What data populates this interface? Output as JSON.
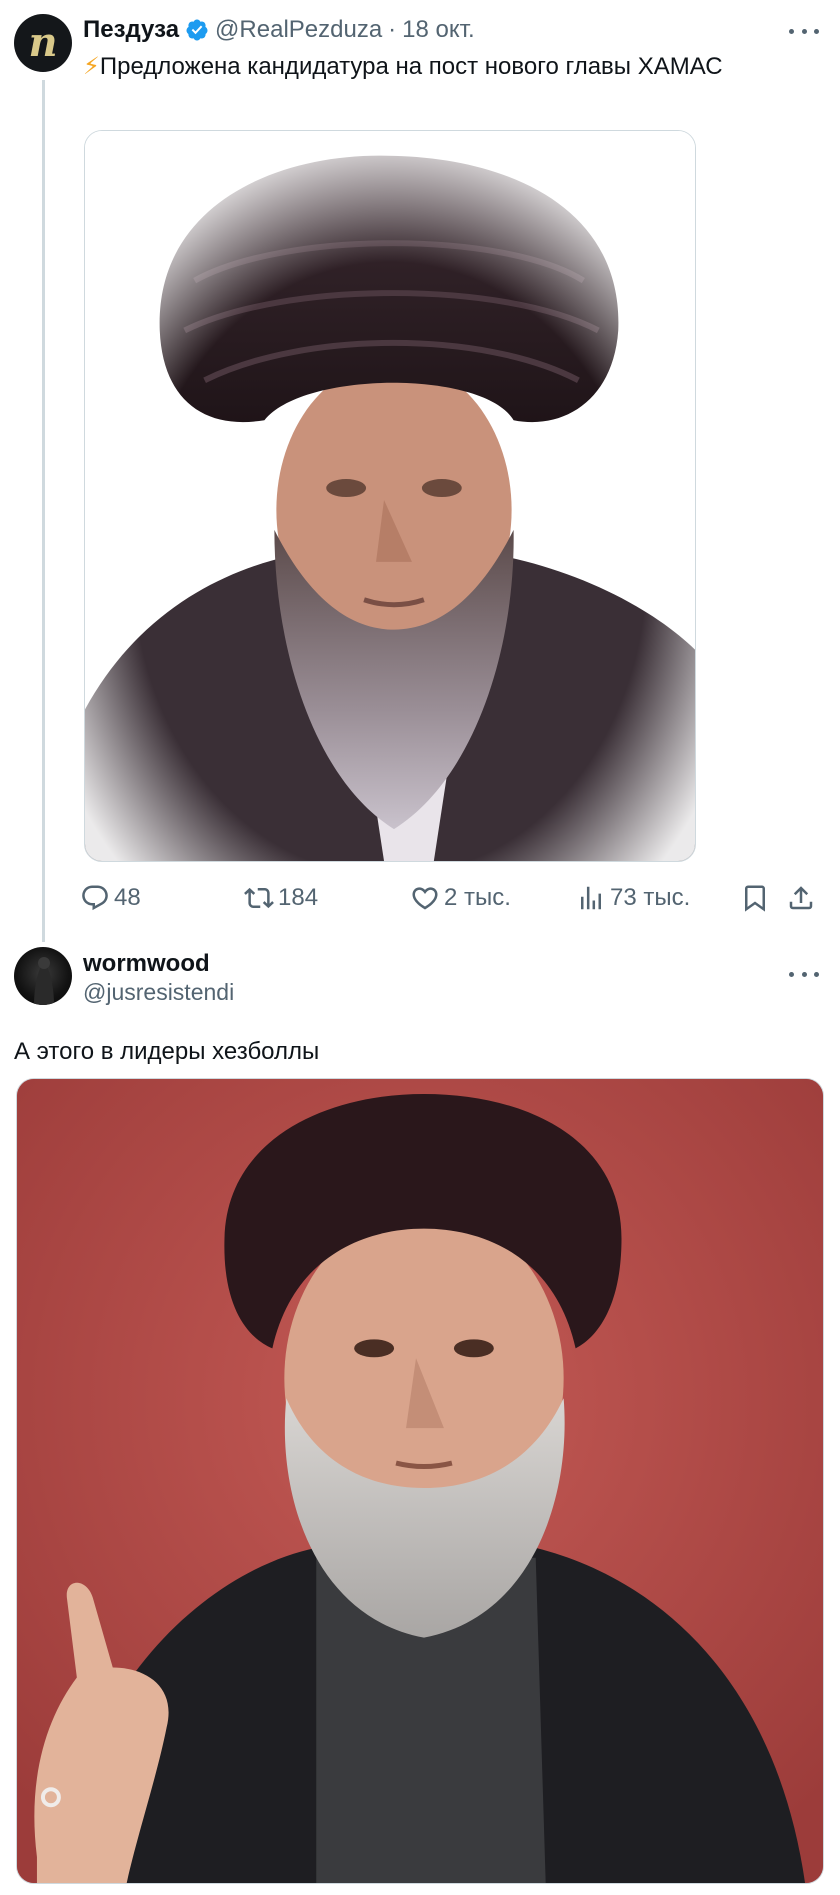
{
  "tweet1": {
    "author_name": "Пездуза",
    "avatar_letter": "n",
    "handle": "@RealPezduza",
    "separator": "·",
    "date": "18 окт.",
    "emoji": "⚡",
    "text": "Предложена кандидатура на пост нового главы ХАМАС",
    "stats": {
      "replies": "48",
      "reposts": "184",
      "likes": "2 тыс.",
      "views": "73 тыс."
    }
  },
  "tweet2": {
    "author_name": "wormwood",
    "handle": "@jusresistendi",
    "text": "А этого в лидеры хезболлы"
  },
  "colors": {
    "text_primary": "#0f1419",
    "text_secondary": "#536471",
    "verified_blue": "#1d9bf0",
    "border": "#cfd9de",
    "media2_background": "#b24a47"
  },
  "icons": [
    "verified-badge-icon",
    "more-icon",
    "reply-icon",
    "repost-icon",
    "like-icon",
    "views-icon",
    "bookmark-icon",
    "share-icon"
  ]
}
